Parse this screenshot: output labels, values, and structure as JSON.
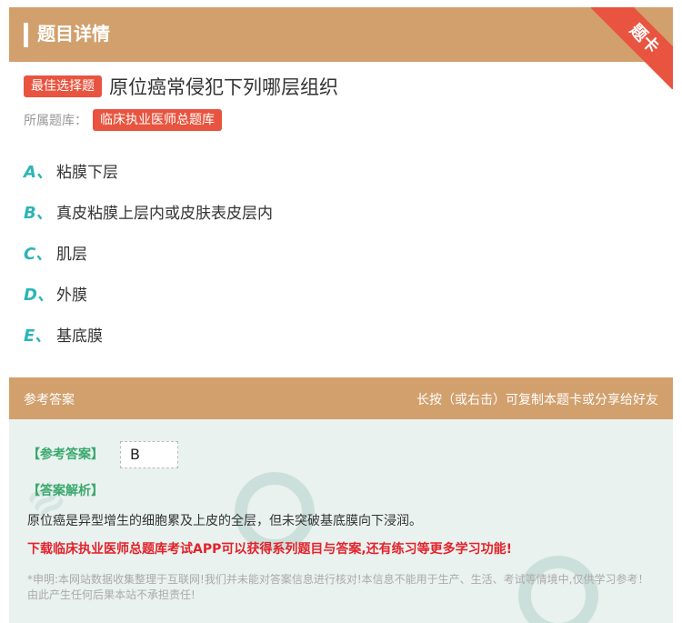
{
  "header": {
    "title": "题目详情",
    "ribbon": "题卡"
  },
  "question": {
    "type_tag": "最佳选择题",
    "text": "原位癌常侵犯下列哪层组织",
    "bank_label": "所属题库：",
    "bank_name": "临床执业医师总题库"
  },
  "options": [
    {
      "letter": "A、",
      "text": "粘膜下层"
    },
    {
      "letter": "B、",
      "text": "真皮粘膜上层内或皮肤表皮层内"
    },
    {
      "letter": "C、",
      "text": "肌层"
    },
    {
      "letter": "D、",
      "text": "外膜"
    },
    {
      "letter": "E、",
      "text": "基底膜"
    }
  ],
  "answer_section": {
    "title": "参考答案",
    "hint": "长按（或右击）可复制本题卡或分享给好友",
    "answer_label": "【参考答案】",
    "answer_value": "B",
    "analysis_label": "【答案解析】",
    "analysis_text": "原位癌是异型增生的细胞累及上皮的全层，但未突破基底膜向下浸润。",
    "promo": "下载临床执业医师总题库考试APP可以获得系列题目与答案,还有练习等更多学习功能!",
    "disclaimer": "*申明:本网站数据收集整理于互联网!我们并未能对答案信息进行核对!本信息不能用于生产、生活、考试等情境中,仅供学习参考！由此产生任何后果本站不承担责任!"
  },
  "colors": {
    "header_bg": "#d2a06d",
    "tag_red": "#e8543f",
    "option_letter": "#2bb5b7",
    "answer_green": "#3aa86d",
    "promo_red": "#e4222b"
  }
}
